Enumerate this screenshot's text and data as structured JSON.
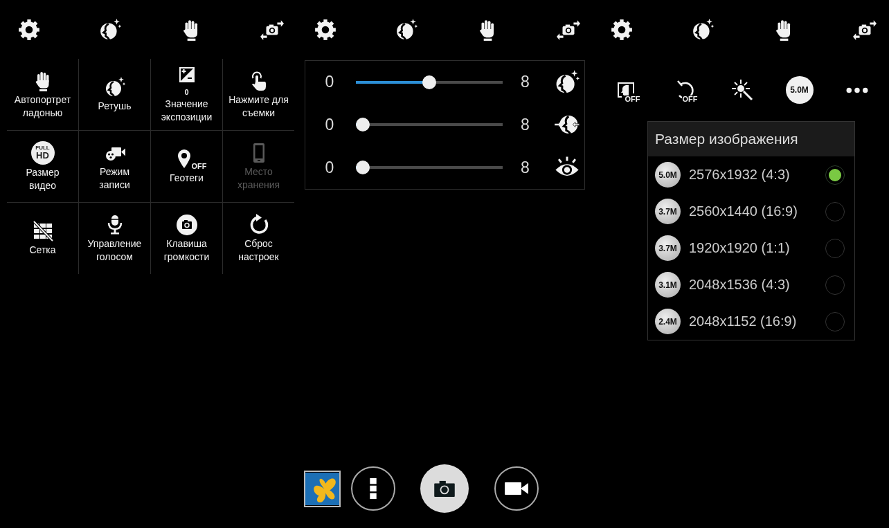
{
  "screens": [
    {
      "kind": "settings_grid",
      "settings": [
        {
          "kind": "palm",
          "label": "Автопортрет\nладонью",
          "disabled": false
        },
        {
          "kind": "beauty",
          "label": "Ретушь",
          "disabled": false
        },
        {
          "kind": "exposure",
          "label": "Значение\nэкспозиции",
          "value": "0",
          "disabled": false
        },
        {
          "kind": "tap",
          "label": "Нажмите для\nсъемки",
          "disabled": false
        },
        {
          "kind": "video_size",
          "label": "Размер\nвидео",
          "icon_text": [
            "FULL",
            "HD"
          ],
          "disabled": false
        },
        {
          "kind": "recording",
          "label": "Режим\nзаписи",
          "disabled": false
        },
        {
          "kind": "geotag",
          "label": "Геотеги",
          "badge": "OFF",
          "disabled": false
        },
        {
          "kind": "storage",
          "label": "Место\nхранения",
          "disabled": true
        },
        {
          "kind": "grid",
          "label": "Сетка",
          "disabled": false
        },
        {
          "kind": "voice",
          "label": "Управление\nголосом",
          "disabled": false
        },
        {
          "kind": "volume_key",
          "label": "Клавиша\nгромкости",
          "disabled": false
        },
        {
          "kind": "reset",
          "label": "Сброс\nнастроек",
          "disabled": false
        }
      ]
    },
    {
      "kind": "beauty_sliders",
      "sliders": [
        {
          "kind": "beauty",
          "min": "0",
          "max": "8",
          "level": 0.5
        },
        {
          "kind": "slim",
          "min": "0",
          "max": "8",
          "level": 0
        },
        {
          "kind": "eye",
          "min": "0",
          "max": "8",
          "level": 0
        }
      ]
    },
    {
      "kind": "image_size",
      "toolbar": [
        {
          "kind": "face",
          "badge": "OFF"
        },
        {
          "kind": "timer",
          "badge": "OFF"
        },
        {
          "kind": "effect"
        },
        {
          "kind": "size",
          "text": "5.0M"
        },
        {
          "kind": "more"
        }
      ],
      "popup": {
        "title": "Размер изображения",
        "options": [
          {
            "badge": "5.0M",
            "label": "2576x1932 (4:3)",
            "selected": true
          },
          {
            "badge": "3.7M",
            "label": "2560x1440 (16:9)",
            "selected": false
          },
          {
            "badge": "3.7M",
            "label": "1920x1920 (1:1)",
            "selected": false
          },
          {
            "badge": "3.1M",
            "label": "2048x1536 (4:3)",
            "selected": false
          },
          {
            "badge": "2.4M",
            "label": "2048x1152 (16:9)",
            "selected": false
          }
        ]
      }
    }
  ]
}
